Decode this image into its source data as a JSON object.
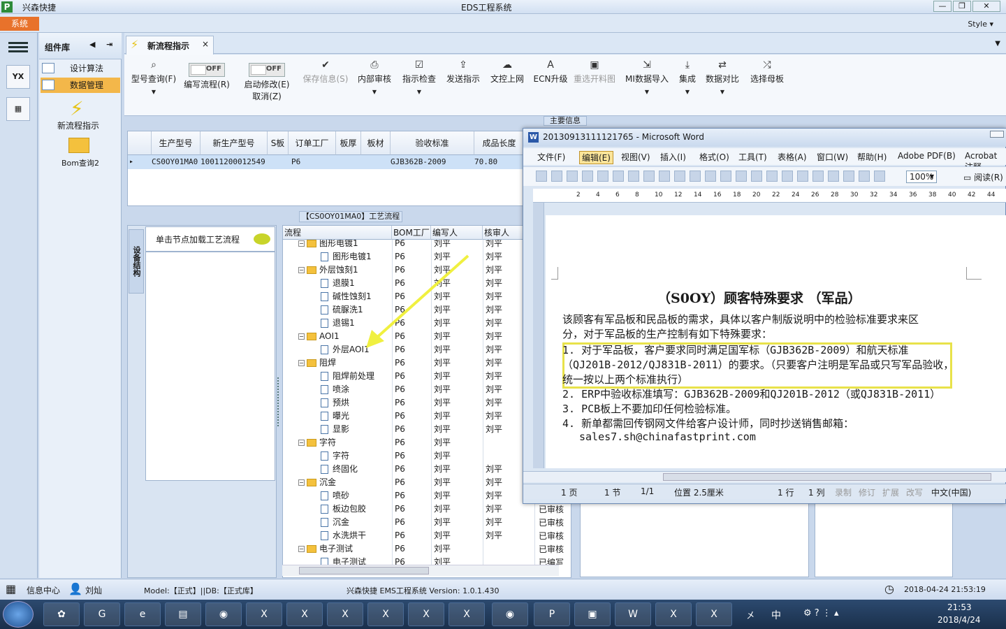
{
  "app": {
    "name": "兴森快捷",
    "window_title": "EDS工程系统",
    "system_btn": "系统",
    "style_label": "Style"
  },
  "sidebar": {
    "header": "组件库",
    "items": [
      {
        "label": "设计算法"
      },
      {
        "label": "数据管理",
        "selected": true
      }
    ],
    "big_items": [
      {
        "label": "新流程指示"
      },
      {
        "label": "Bom查询2"
      }
    ]
  },
  "tab": {
    "label": "新流程指示",
    "close": "×"
  },
  "ribbon": {
    "items": [
      {
        "label": "型号查询(F)",
        "icon": "search-icon",
        "dropdown": true
      },
      {
        "label": "编写流程(R)",
        "toggle": "OFF"
      },
      {
        "label": "启动修改(E)",
        "toggle": "OFF",
        "sublabel": "取消(Z)"
      },
      {
        "label": "保存信息(S)",
        "icon": "check-icon",
        "disabled": true
      },
      {
        "label": "内部审核",
        "icon": "print-icon",
        "dropdown": true
      },
      {
        "label": "指示检查",
        "icon": "checkbox-icon",
        "dropdown": true
      },
      {
        "label": "发送指示",
        "icon": "upload-icon"
      },
      {
        "label": "文控上网",
        "icon": "cloud-upload-icon"
      },
      {
        "label": "ECN升级",
        "icon": "font-a-icon"
      },
      {
        "label": "重选开料图",
        "icon": "image-icon",
        "disabled": true
      },
      {
        "label": "MI数据导入",
        "icon": "import-icon",
        "dropdown": true
      },
      {
        "label": "集成",
        "icon": "download-icon",
        "dropdown": true
      },
      {
        "label": "数据对比",
        "icon": "compare-icon",
        "dropdown": true
      },
      {
        "label": "选择母板",
        "icon": "shuffle-icon"
      }
    ]
  },
  "main_info": {
    "title": "主要信息",
    "columns": [
      "生产型号",
      "新生产型号",
      "S板",
      "订单工厂",
      "板厚",
      "板材",
      "验收标准",
      "成品长度"
    ],
    "rows": [
      [
        "CS0OY01MA0",
        "10011200012549",
        "",
        "P6",
        "",
        "",
        "GJB362B-2009",
        "70.80"
      ]
    ]
  },
  "process": {
    "title": "【CS0OY01MA0】工艺流程",
    "equip_tab": "设备结构",
    "node_hint": "单击节点加载工艺流程",
    "columns": [
      "流程",
      "BOM工厂",
      "编写人",
      "核审人"
    ],
    "rows": [
      {
        "name": "图形电镀1",
        "level": 1,
        "folder": true,
        "factory": "P6",
        "author": "刘平",
        "reviewer": "刘平"
      },
      {
        "name": "图形电镀1",
        "level": 2,
        "folder": false,
        "factory": "P6",
        "author": "刘平",
        "reviewer": "刘平"
      },
      {
        "name": "外层蚀刻1",
        "level": 1,
        "folder": true,
        "factory": "P6",
        "author": "刘平",
        "reviewer": "刘平"
      },
      {
        "name": "退膜1",
        "level": 2,
        "folder": false,
        "factory": "P6",
        "author": "刘平",
        "reviewer": "刘平"
      },
      {
        "name": "碱性蚀刻1",
        "level": 2,
        "folder": false,
        "factory": "P6",
        "author": "刘平",
        "reviewer": "刘平"
      },
      {
        "name": "硫脲洗1",
        "level": 2,
        "folder": false,
        "factory": "P6",
        "author": "刘平",
        "reviewer": "刘平"
      },
      {
        "name": "退锡1",
        "level": 2,
        "folder": false,
        "factory": "P6",
        "author": "刘平",
        "reviewer": "刘平"
      },
      {
        "name": "AOI1",
        "level": 1,
        "folder": true,
        "factory": "P6",
        "author": "刘平",
        "reviewer": "刘平"
      },
      {
        "name": "外层AOI1",
        "level": 2,
        "folder": false,
        "factory": "P6",
        "author": "刘平",
        "reviewer": "刘平"
      },
      {
        "name": "阻焊",
        "level": 1,
        "folder": true,
        "factory": "P6",
        "author": "刘平",
        "reviewer": "刘平"
      },
      {
        "name": "阻焊前处理",
        "level": 2,
        "folder": false,
        "factory": "P6",
        "author": "刘平",
        "reviewer": "刘平"
      },
      {
        "name": "喷涂",
        "level": 2,
        "folder": false,
        "factory": "P6",
        "author": "刘平",
        "reviewer": "刘平"
      },
      {
        "name": "预烘",
        "level": 2,
        "folder": false,
        "factory": "P6",
        "author": "刘平",
        "reviewer": "刘平"
      },
      {
        "name": "曝光",
        "level": 2,
        "folder": false,
        "factory": "P6",
        "author": "刘平",
        "reviewer": "刘平"
      },
      {
        "name": "显影",
        "level": 2,
        "folder": false,
        "factory": "P6",
        "author": "刘平",
        "reviewer": "刘平"
      },
      {
        "name": "字符",
        "level": 1,
        "folder": true,
        "factory": "P6",
        "author": "刘平",
        "reviewer": ""
      },
      {
        "name": "字符",
        "level": 2,
        "folder": false,
        "factory": "P6",
        "author": "刘平",
        "reviewer": ""
      },
      {
        "name": "终固化",
        "level": 2,
        "folder": false,
        "factory": "P6",
        "author": "刘平",
        "reviewer": "刘平"
      },
      {
        "name": "沉金",
        "level": 1,
        "folder": true,
        "factory": "P6",
        "author": "刘平",
        "reviewer": "刘平"
      },
      {
        "name": "喷砂",
        "level": 2,
        "folder": false,
        "factory": "P6",
        "author": "刘平",
        "reviewer": "刘平"
      },
      {
        "name": "板边包胶",
        "level": 2,
        "folder": false,
        "factory": "P6",
        "author": "刘平",
        "reviewer": "刘平"
      },
      {
        "name": "沉金",
        "level": 2,
        "folder": false,
        "factory": "P6",
        "author": "刘平",
        "reviewer": "刘平"
      },
      {
        "name": "水洗烘干",
        "level": 2,
        "folder": false,
        "factory": "P6",
        "author": "刘平",
        "reviewer": "刘平"
      },
      {
        "name": "电子测试",
        "level": 1,
        "folder": true,
        "factory": "P6",
        "author": "刘平",
        "reviewer": ""
      },
      {
        "name": "电子测试",
        "level": 2,
        "folder": false,
        "factory": "P6",
        "author": "刘平",
        "reviewer": ""
      }
    ],
    "status_col": [
      "已审核",
      "已审核",
      "已审核",
      "已审核",
      "已编写",
      "已编写"
    ]
  },
  "statusbar": {
    "info_center": "信息中心",
    "user": "刘灿",
    "model": "Model:【正式】||DB:【正式库】",
    "version": "兴森快捷 EMS工程系统 Version: 1.0.1.430",
    "datetime": "2018-04-24 21:53:19"
  },
  "taskbar": {
    "time": "21:53",
    "date": "2018/4/24",
    "ime": "中"
  },
  "word": {
    "title": "20130913111121765 - Microsoft Word",
    "menu": [
      "文件(F)",
      "编辑(E)",
      "视图(V)",
      "插入(I)",
      "格式(O)",
      "工具(T)",
      "表格(A)",
      "窗口(W)",
      "帮助(H)",
      "Adobe PDF(B)",
      "Acrobat 注释"
    ],
    "zoom": "100%",
    "read_label": "阅读(R)",
    "ruler": [
      "2",
      "4",
      "6",
      "8",
      "10",
      "12",
      "14",
      "16",
      "18",
      "20",
      "22",
      "24",
      "26",
      "28",
      "30",
      "32",
      "34",
      "36",
      "38",
      "40",
      "42",
      "44"
    ],
    "doc_title": "（S0OY）顾客特殊要求 （军品）",
    "para": [
      "该顾客有军品板和民品板的需求，具体以客户制版说明中的检验标准要求来区",
      "分，对于军品板的生产控制有如下特殊要求："
    ],
    "items": [
      "1. 对于军品板，客户要求同时满足国军标（GJB362B-2009）和航天标准",
      "（QJ201B-2012/QJ831B-2011）的要求。（只要客户注明是军品或只写军品验收，",
      "统一按以上两个标准执行）",
      "2. ERP中验收标准填写：GJB362B-2009和QJ201B-2012（或QJ831B-2011）",
      "3. PCB板上不要加印任何检验标准。",
      "4. 新单都需回传钢网文件给客户设计师，同时抄送销售邮箱：",
      "sales7.sh@chinafastprint.com"
    ],
    "status": [
      "1 页",
      "1 节",
      "1/1",
      "位置 2.5厘米",
      "1 行",
      "1 列",
      "录制",
      "修订",
      "扩展",
      "改写",
      "中文(中国)"
    ]
  },
  "colors": {
    "accent": "#e8722b",
    "highlight": "#e8e24a",
    "arrow": "#f0f040"
  }
}
